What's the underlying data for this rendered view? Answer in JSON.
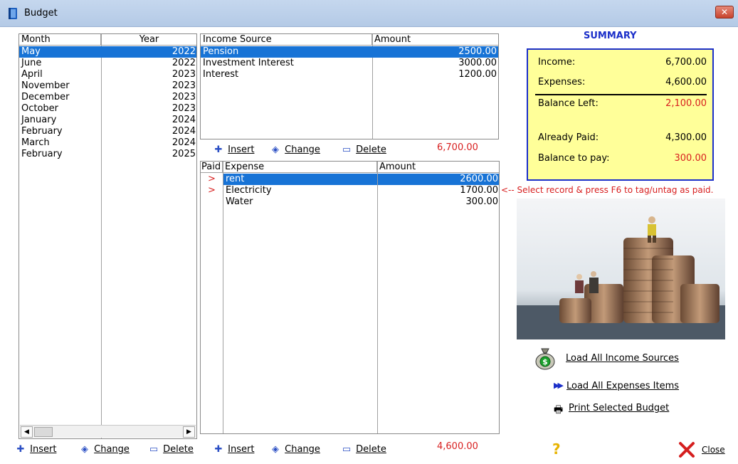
{
  "window": {
    "title": "Budget",
    "close_glyph": "✕"
  },
  "months": {
    "headers": [
      "Month",
      "Year"
    ],
    "rows": [
      {
        "month": "May",
        "year": "2022"
      },
      {
        "month": "June",
        "year": "2022"
      },
      {
        "month": "April",
        "year": "2023"
      },
      {
        "month": "November",
        "year": "2023"
      },
      {
        "month": "December",
        "year": "2023"
      },
      {
        "month": "October",
        "year": "2023"
      },
      {
        "month": "January",
        "year": "2024"
      },
      {
        "month": "February",
        "year": "2024"
      },
      {
        "month": "March",
        "year": "2024"
      },
      {
        "month": "February",
        "year": "2025"
      }
    ],
    "selected_index": 0
  },
  "income": {
    "headers": [
      "Income Source",
      "Amount"
    ],
    "rows": [
      {
        "source": "Pension",
        "amount": "2500.00"
      },
      {
        "source": "Investment Interest",
        "amount": "3000.00"
      },
      {
        "source": "Interest",
        "amount": "1200.00"
      }
    ],
    "selected_index": 0,
    "total": "6,700.00"
  },
  "expenses": {
    "headers": [
      "Paid",
      "Expense",
      "Amount"
    ],
    "rows": [
      {
        "paid": ">",
        "expense": "rent",
        "amount": "2600.00"
      },
      {
        "paid": ">",
        "expense": "Electricity",
        "amount": "1700.00"
      },
      {
        "paid": "",
        "expense": "Water",
        "amount": "300.00"
      }
    ],
    "selected_index": 0,
    "total": "4,600.00"
  },
  "toolbar": {
    "insert_label": "Insert",
    "change_label": "Change",
    "delete_label": "Delete",
    "insert_t_label": "Insert",
    "insert_i_icon": "plus-outline-icon",
    "change_icon": "diamond-arrows-icon",
    "delete_icon": "minus-outline-icon"
  },
  "summary": {
    "title": "SUMMARY",
    "income_label": "Income:",
    "income_value": "6,700.00",
    "expenses_label": "Expenses:",
    "expenses_value": "4,600.00",
    "balance_left_label": "Balance Left:",
    "balance_left_value": "2,100.00",
    "already_paid_label": "Already Paid:",
    "already_paid_value": "4,300.00",
    "balance_to_pay_label": "Balance to pay:",
    "balance_to_pay_value": "300.00"
  },
  "hint": "<-- Select record & press F6 to tag/untag as paid.",
  "actions": {
    "load_income_label": "Load All Income Sources",
    "load_expenses_label": "Load All Expenses Items",
    "print_label": "Print Selected Budget",
    "help_glyph": "?",
    "close_label": "Close"
  },
  "colors": {
    "selection": "#1773d6",
    "red_text": "#d82020",
    "summary_border": "#1b2fc9",
    "summary_bg": "#ffff99"
  }
}
